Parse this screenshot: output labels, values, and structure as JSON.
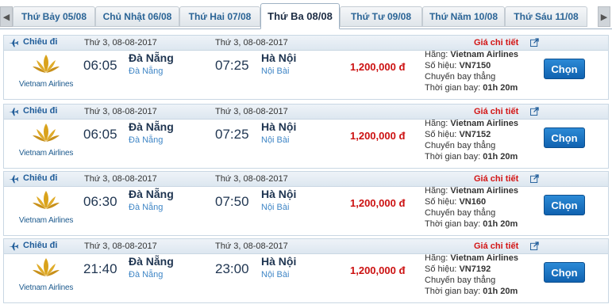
{
  "tabs": {
    "prev_icon": "chevron-left-icon",
    "next_icon": "chevron-right-icon",
    "items": [
      {
        "label": "Thứ Bảy 05/08"
      },
      {
        "label": "Chủ Nhật 06/08"
      },
      {
        "label": "Thứ Hai 07/08"
      },
      {
        "label": "Thứ Ba 08/08",
        "active": true
      },
      {
        "label": "Thứ Tư 09/08"
      },
      {
        "label": "Thứ Năm 10/08"
      },
      {
        "label": "Thứ Sáu 11/08"
      }
    ]
  },
  "colors": {
    "link_blue": "#1f5c99",
    "price_red": "#cc1111",
    "button_blue": "#1062b0",
    "airport_blue": "#3f86c6"
  },
  "flights": [
    {
      "direction": "Chiêu đi",
      "dep_date": "Thứ 3, 08-08-2017",
      "arr_date": "Thứ 3, 08-08-2017",
      "detail_label": "Giá chi tiết",
      "airline_logo_text": "Vietnam Airlines",
      "dep_time": "06:05",
      "dep_city": "Đà Nẵng",
      "dep_airport": "Đà Nẵng",
      "arr_time": "07:25",
      "arr_city": "Hà Nội",
      "arr_airport": "Nội Bài",
      "price": "1,200,000 đ",
      "airline_label": "Hãng:",
      "airline": "Vietnam Airlines",
      "flight_no_label": "Số hiệu:",
      "flight_no": "VN7150",
      "flight_type": "Chuyến bay thẳng",
      "duration_label": "Thời gian bay:",
      "duration": "01h 20m",
      "button": "Chọn"
    },
    {
      "direction": "Chiêu đi",
      "dep_date": "Thứ 3, 08-08-2017",
      "arr_date": "Thứ 3, 08-08-2017",
      "detail_label": "Giá chi tiết",
      "airline_logo_text": "Vietnam Airlines",
      "dep_time": "06:05",
      "dep_city": "Đà Nẵng",
      "dep_airport": "Đà Nẵng",
      "arr_time": "07:25",
      "arr_city": "Hà Nội",
      "arr_airport": "Nội Bài",
      "price": "1,200,000 đ",
      "airline_label": "Hãng:",
      "airline": "Vietnam Airlines",
      "flight_no_label": "Số hiệu:",
      "flight_no": "VN7152",
      "flight_type": "Chuyến bay thẳng",
      "duration_label": "Thời gian bay:",
      "duration": "01h 20m",
      "button": "Chọn"
    },
    {
      "direction": "Chiêu đi",
      "dep_date": "Thứ 3, 08-08-2017",
      "arr_date": "Thứ 3, 08-08-2017",
      "detail_label": "Giá chi tiết",
      "airline_logo_text": "Vietnam Airlines",
      "dep_time": "06:30",
      "dep_city": "Đà Nẵng",
      "dep_airport": "Đà Nẵng",
      "arr_time": "07:50",
      "arr_city": "Hà Nội",
      "arr_airport": "Nội Bài",
      "price": "1,200,000 đ",
      "airline_label": "Hãng:",
      "airline": "Vietnam Airlines",
      "flight_no_label": "Số hiệu:",
      "flight_no": "VN160",
      "flight_type": "Chuyến bay thẳng",
      "duration_label": "Thời gian bay:",
      "duration": "01h 20m",
      "button": "Chọn"
    },
    {
      "direction": "Chiêu đi",
      "dep_date": "Thứ 3, 08-08-2017",
      "arr_date": "Thứ 3, 08-08-2017",
      "detail_label": "Giá chi tiết",
      "airline_logo_text": "Vietnam Airlines",
      "dep_time": "21:40",
      "dep_city": "Đà Nẵng",
      "dep_airport": "Đà Nẵng",
      "arr_time": "23:00",
      "arr_city": "Hà Nội",
      "arr_airport": "Nội Bài",
      "price": "1,200,000 đ",
      "airline_label": "Hãng:",
      "airline": "Vietnam Airlines",
      "flight_no_label": "Số hiệu:",
      "flight_no": "VN7192",
      "flight_type": "Chuyến bay thẳng",
      "duration_label": "Thời gian bay:",
      "duration": "01h 20m",
      "button": "Chọn"
    }
  ]
}
